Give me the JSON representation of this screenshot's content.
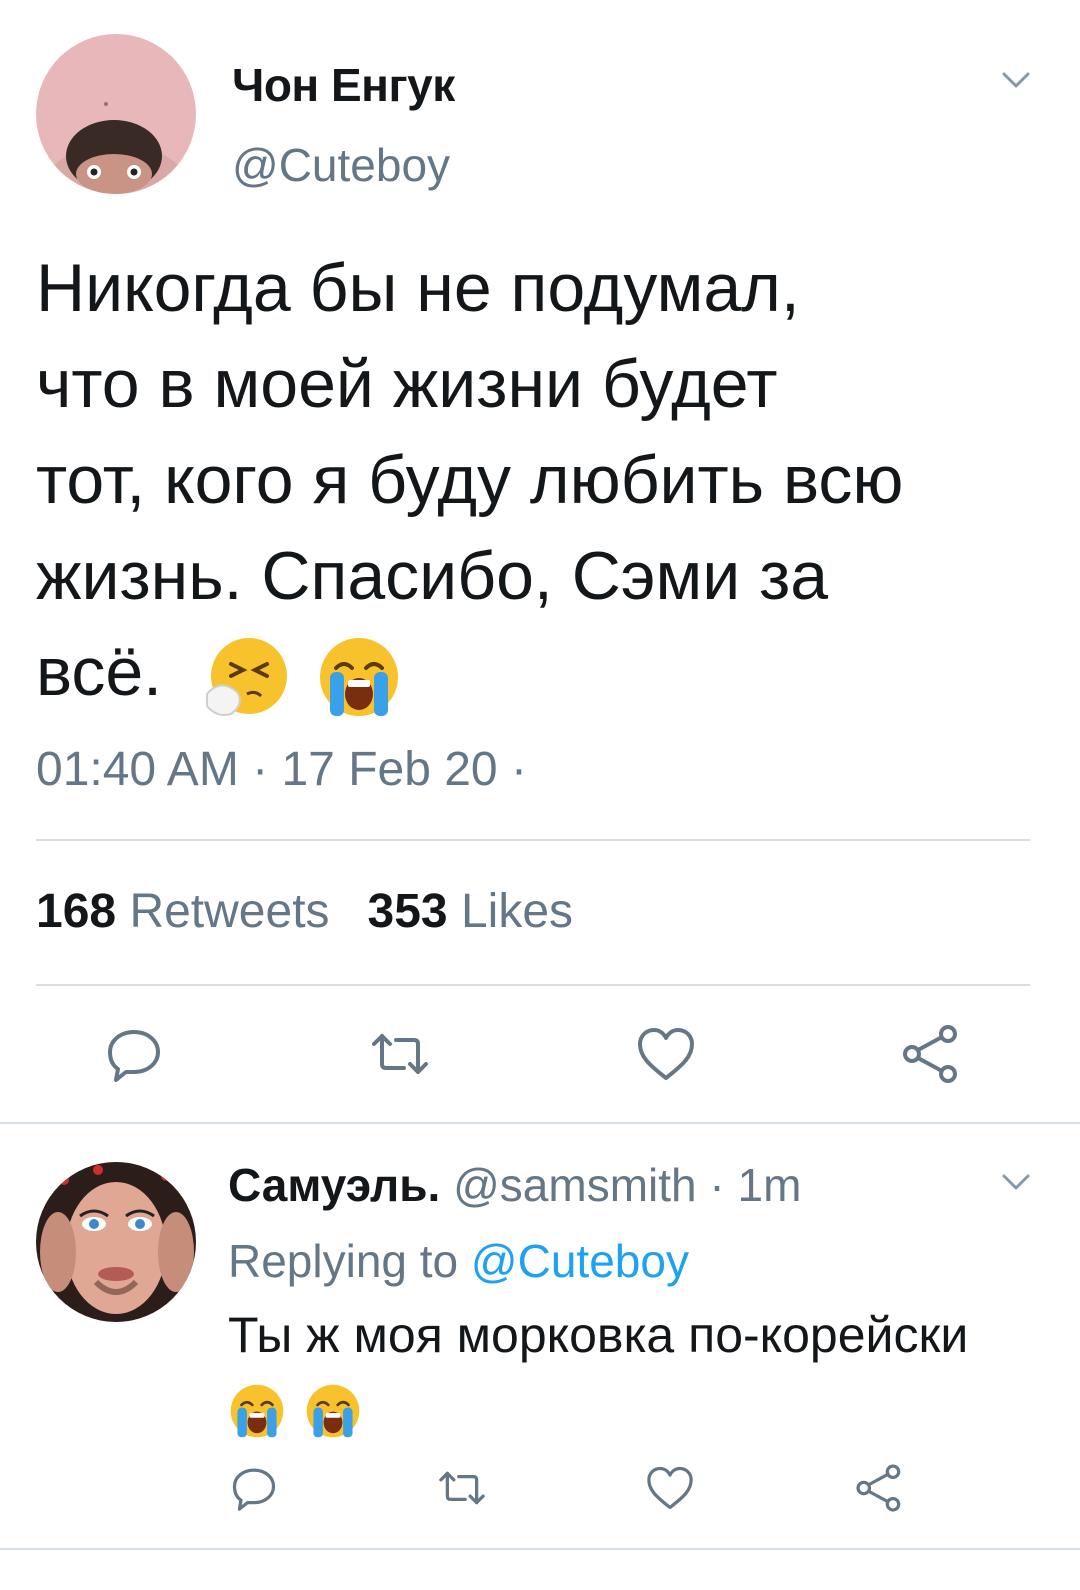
{
  "tweet": {
    "display_name": "Чон Енгук",
    "handle": "@Cuteboy",
    "text_lines": [
      "Никогда бы не подумал,",
      "что в моей жизни будет",
      "тот, кого я буду любить всю",
      "жизнь. Спасибо, Сэми за",
      "всё."
    ],
    "emojis": [
      "sneezing-face-emoji",
      "loudly-crying-face-emoji"
    ],
    "timestamp": "01:40 AM · 17 Feb 20 ·",
    "retweets_count": "168",
    "retweets_label": "Retweets",
    "likes_count": "353",
    "likes_label": "Likes",
    "actions": [
      "reply-icon",
      "retweet-icon",
      "like-icon",
      "share-icon"
    ]
  },
  "reply": {
    "display_name": "Самуэль.",
    "handle": "@samsmith",
    "separator": " · ",
    "time": "1m",
    "replying_prefix": "Replying to",
    "replying_mention": "@Cuteboy",
    "text_lines": [
      "Ты ж моя морковка по-корейски"
    ],
    "emojis": [
      "loudly-crying-face-emoji",
      "loudly-crying-face-emoji"
    ],
    "actions": [
      "reply-icon",
      "retweet-icon",
      "like-icon",
      "share-icon"
    ]
  },
  "colors": {
    "text": "#14171a",
    "secondary": "#657786",
    "link": "#1da1f2",
    "divider": "#d8dfe4",
    "icon": "#657786"
  }
}
